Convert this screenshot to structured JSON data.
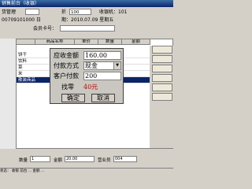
{
  "window": {
    "title": "销售前台（收银）"
  },
  "header": {
    "row1": {
      "label": "货管理",
      "btn1": "",
      "discount_label": "折",
      "discount_value": "100",
      "cashier_label": "收银机：101"
    },
    "row2": {
      "doc_no": "00709101000 日",
      "date_label": "期：2010.07.09 星期五"
    },
    "row3": {
      "member_label": "会员卡号：",
      "member_value": ""
    }
  },
  "grid": {
    "headers": [
      "",
      "商品名称",
      "单价",
      "数量",
      "金额"
    ],
    "rows": [
      {
        "label": "饼干",
        "selected": false
      },
      {
        "label": "饮料",
        "selected": false
      },
      {
        "label": "菜",
        "selected": false
      },
      {
        "label": "米",
        "selected": false
      },
      {
        "label": "散装商品",
        "selected": true
      }
    ]
  },
  "side_buttons": [
    "",
    "",
    "",
    "",
    "",
    ""
  ],
  "dialog": {
    "due_label": "应收金额",
    "due_value": "160.00",
    "method_label": "付款方式",
    "method_value": "现金",
    "paid_label": "客户付款",
    "paid_value": "200",
    "change_label": "找零",
    "change_value": "40元",
    "ok_label": "确定",
    "cancel_label": "取消"
  },
  "footer": {
    "qty_label": "数量",
    "qty_value": "1",
    "amount_label": "金额",
    "amount_value": "20.00",
    "salesman_label": "营业员",
    "salesman_value": "004",
    "status": "状态： 收银 前台 ... 金额 ..."
  },
  "colors": {
    "title_bg": "#0a246a",
    "selected_row": "#0a246a",
    "change_value": "#c00000"
  }
}
